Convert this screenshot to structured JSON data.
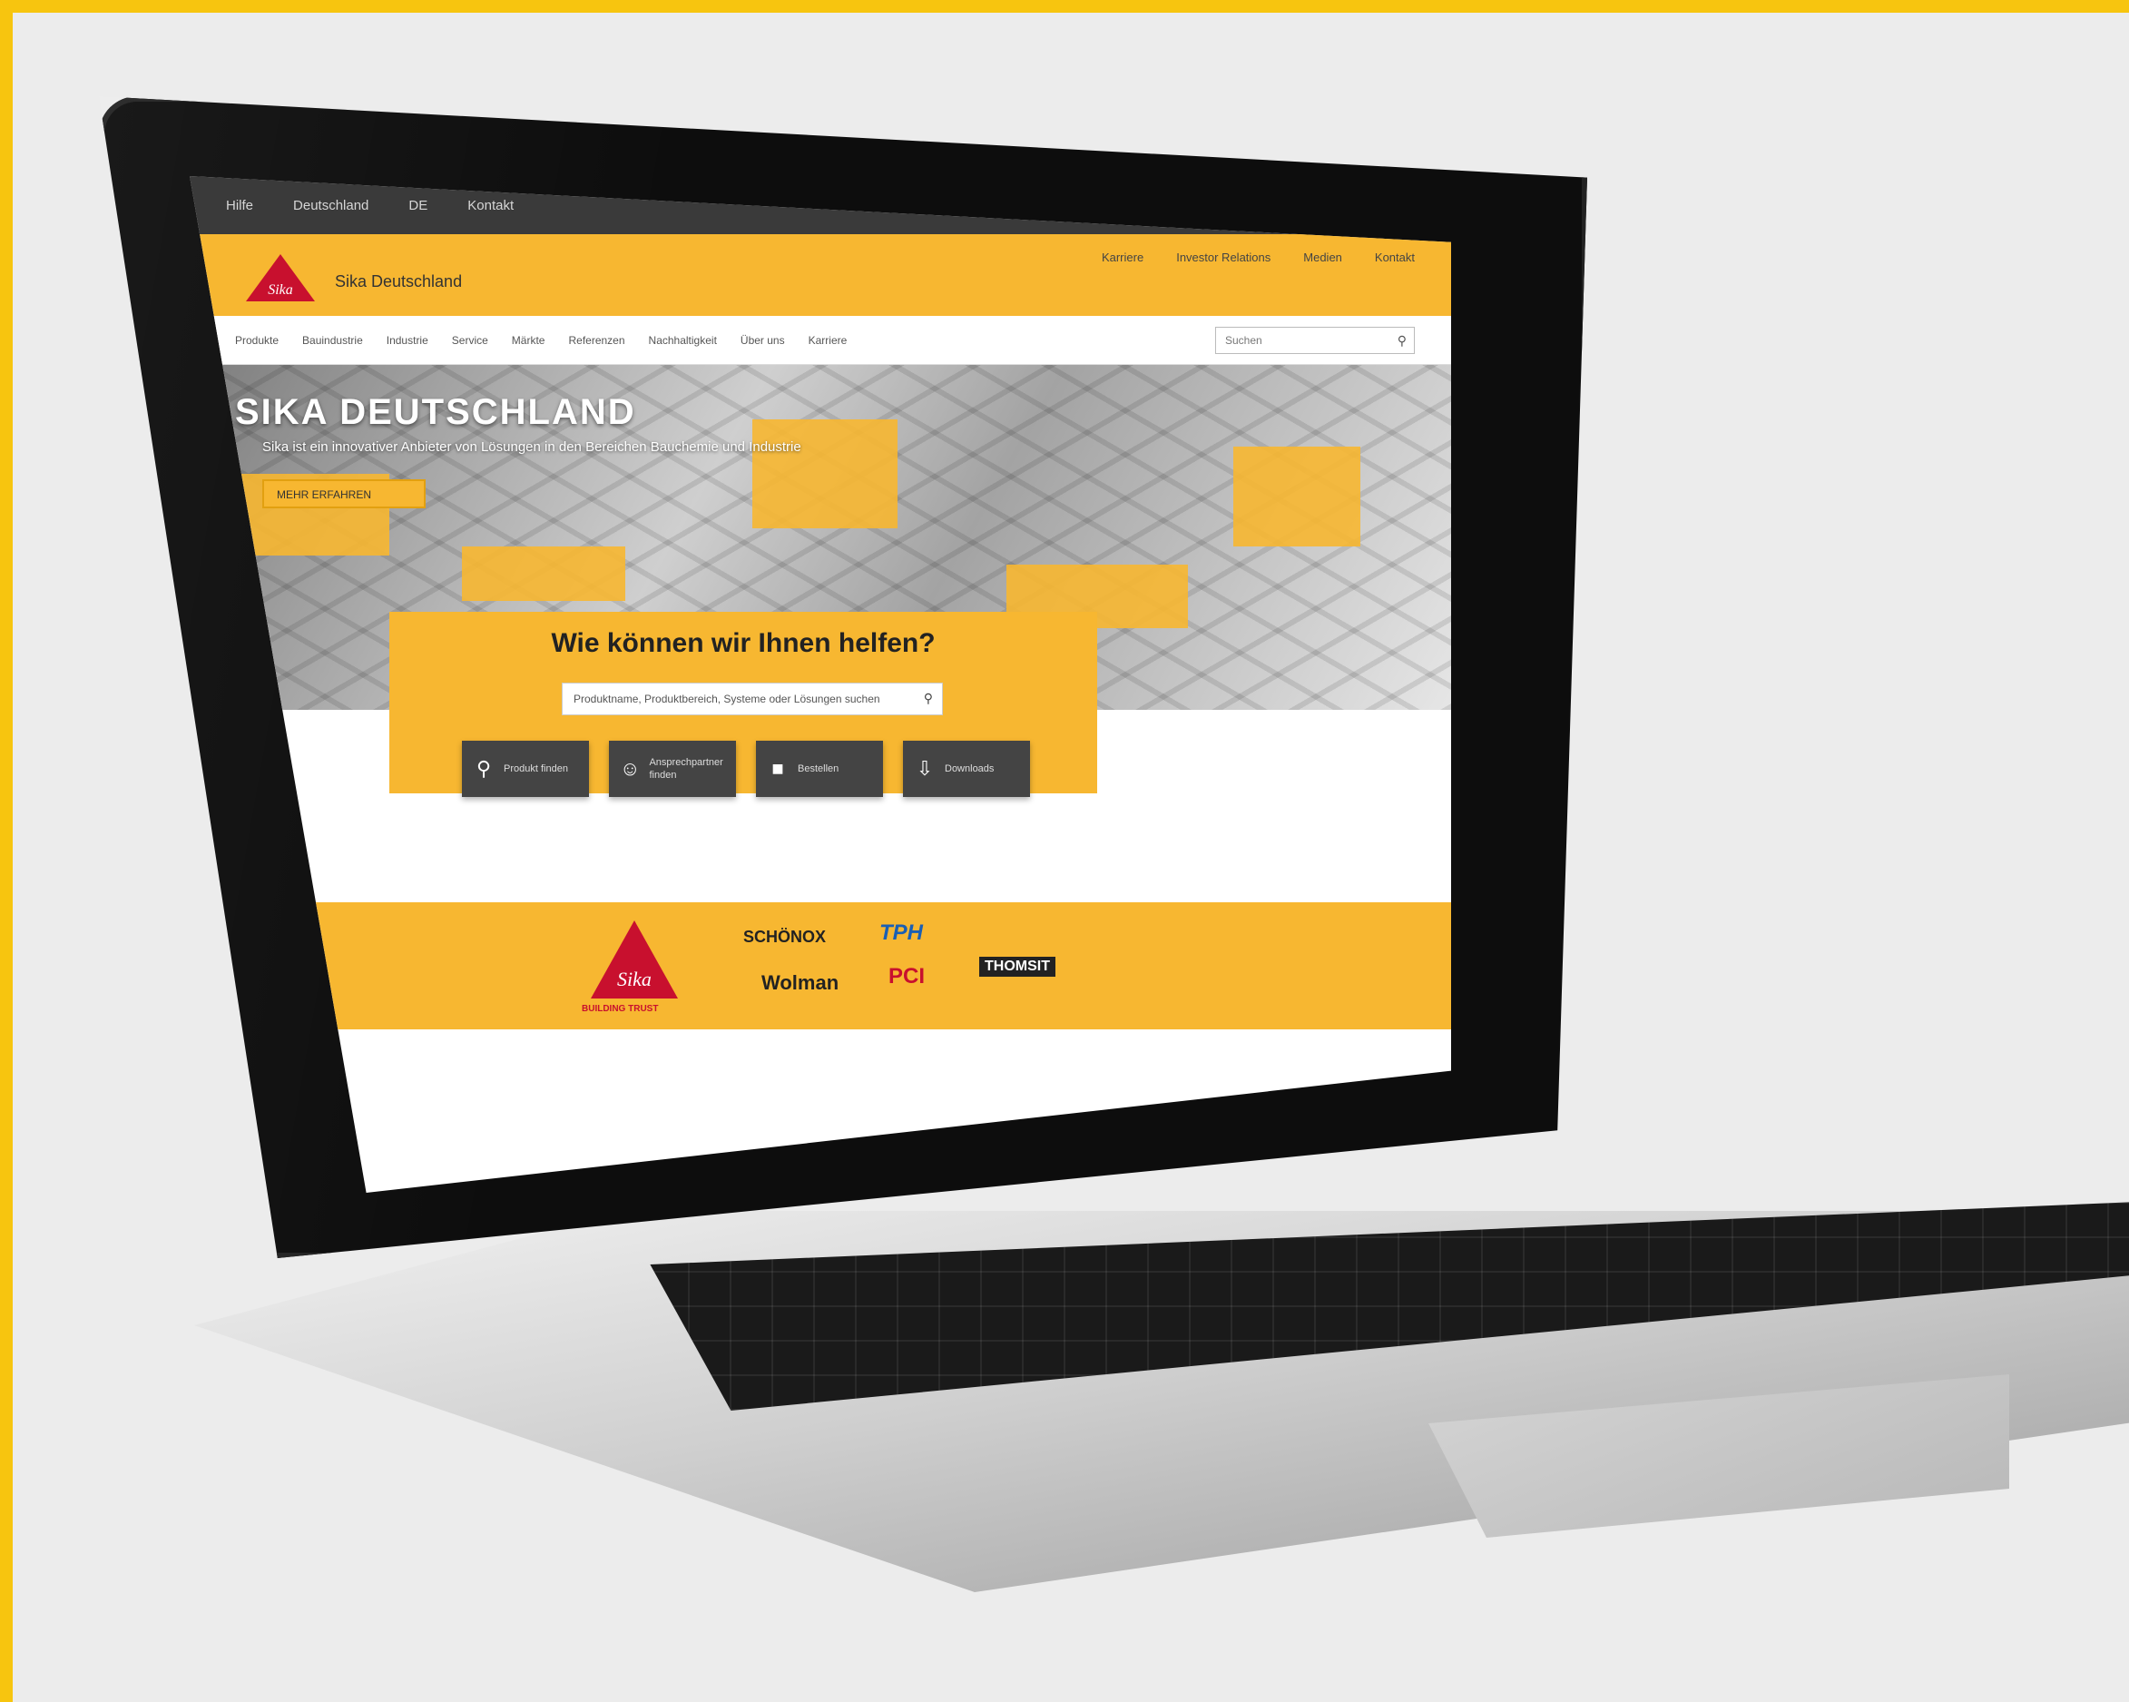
{
  "website": {
    "topbar": [
      "Hilfe",
      "Deutschland",
      "DE",
      "Kontakt"
    ],
    "site_name": "Sika Deutschland",
    "header_links": [
      "Karriere",
      "Investor Relations",
      "Medien",
      "Kontakt"
    ],
    "nav": [
      "Produkte",
      "Bauindustrie",
      "Industrie",
      "Service",
      "Märkte",
      "Referenzen",
      "Nachhaltigkeit",
      "Über uns",
      "Karriere"
    ],
    "search_placeholder": "Suchen",
    "hero": {
      "title": "SIKA DEUTSCHLAND",
      "subtitle": "Sika ist ein innovativer Anbieter von Lösungen in den Bereichen Bauchemie und Industrie",
      "button": "MEHR ERFAHREN"
    },
    "help": {
      "title": "Wie können wir Ihnen helfen?",
      "search_placeholder": "Produktname, Produktbereich, Systeme oder Lösungen suchen"
    },
    "tiles": [
      {
        "icon": "search-icon",
        "label": "Produkt finden"
      },
      {
        "icon": "person-icon",
        "label": "Ansprechpartner finden"
      },
      {
        "icon": "cart-icon",
        "label": "Bestellen"
      },
      {
        "icon": "download-icon",
        "label": "Downloads"
      }
    ],
    "brands": {
      "main_logo_text": "Sika",
      "main_logo_sub": "BUILDING TRUST",
      "items": [
        "SCHÖNOX",
        "TPH",
        "Wolman",
        "PCI",
        "THOMSIT"
      ]
    }
  },
  "colors": {
    "brand_yellow": "#f7b731",
    "sika_red": "#c8102e",
    "dark_gray": "#444444"
  }
}
